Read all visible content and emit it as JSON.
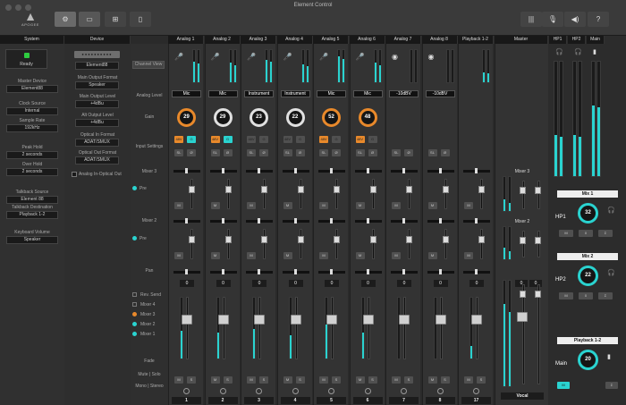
{
  "window": {
    "title": "Element Control"
  },
  "logo": {
    "brand": "APOGEE"
  },
  "toolbar": {
    "left_icons": [
      "settings-icon",
      "device-icon",
      "io-icon",
      "remote-icon"
    ],
    "right_icons": [
      "meter-icon",
      "mic-icon",
      "speaker-icon",
      "help-icon"
    ]
  },
  "system": {
    "header": "System",
    "status": "Ready",
    "fields": [
      {
        "label": "Master Device",
        "value": "Element88"
      },
      {
        "label": "Clock Source",
        "value": "Internal"
      },
      {
        "label": "Sample Rate",
        "value": "192kHz"
      },
      {
        "label": "Peak Hold",
        "value": "2 seconds"
      },
      {
        "label": "Over Hold",
        "value": "2 seconds"
      },
      {
        "label": "Talkback Source",
        "value": "Element 88"
      },
      {
        "label": "Talkback Destination",
        "value": "Playback 1-2"
      },
      {
        "label": "Keyboard Volume",
        "value": "Speaker"
      }
    ]
  },
  "device": {
    "header": "Device",
    "name": "Element88",
    "fields": [
      {
        "label": "Main Output Format",
        "value": "Speaker"
      },
      {
        "label": "Main Output Level",
        "value": "+4dBu"
      },
      {
        "label": "Alt Output Level",
        "value": "+4dBu"
      },
      {
        "label": "Optical In Format",
        "value": "ADAT/SMUX"
      },
      {
        "label": "Optical Out Format",
        "value": "ADAT/SMUX"
      }
    ],
    "checkbox_label": "Analog In-Optical Out"
  },
  "rows": {
    "channel_view": "Channel View",
    "analog_level": "Analog Level",
    "gain": "Gain",
    "input_settings": "Input Settings",
    "mixer3": "Mixer 3",
    "pre": "Pre",
    "mixer2": "Mixer 2",
    "pan": "Pan",
    "rev_send": "Rev. Send",
    "mixer4": "Mixer 4",
    "mixer3b": "Mixer 3",
    "mixer2b": "Mixer 2",
    "mixer1": "Mixer 1",
    "fade": "Fade",
    "mute_solo": "Mute | Solo",
    "mono_stereo": "Mono | Stereo"
  },
  "channels": [
    {
      "name": "Analog 1",
      "level": "Mic",
      "gain": "29",
      "ring": "#e8892b",
      "pan": "0",
      "num": "1",
      "meter": 0.65
    },
    {
      "name": "Analog 2",
      "level": "Mic",
      "gain": "29",
      "ring": "#e0e0e0",
      "pan": "0",
      "num": "2",
      "meter": 0.6
    },
    {
      "name": "Analog 3",
      "level": "Instrument",
      "gain": "23",
      "ring": "#e0e0e0",
      "pan": "0",
      "num": "3",
      "meter": 0.7
    },
    {
      "name": "Analog 4",
      "level": "Instrument",
      "gain": "22",
      "ring": "#e0e0e0",
      "pan": "0",
      "num": "4",
      "meter": 0.55
    },
    {
      "name": "Analog 5",
      "level": "Mic",
      "gain": "52",
      "ring": "#e8892b",
      "pan": "0",
      "num": "5",
      "meter": 0.8
    },
    {
      "name": "Analog 6",
      "level": "Mic",
      "gain": "48",
      "ring": "#e8892b",
      "pan": "0",
      "num": "6",
      "meter": 0.6
    },
    {
      "name": "Analog 7",
      "level": "-10dBV",
      "gain": "",
      "ring": "",
      "pan": "0",
      "num": "7",
      "meter": 0.0
    },
    {
      "name": "Analog 8",
      "level": "-10dBV",
      "gain": "",
      "ring": "",
      "pan": "0",
      "num": "8",
      "meter": 0.0
    },
    {
      "name": "Playback 1-2",
      "level": "",
      "gain": "",
      "ring": "",
      "pan": "0",
      "num": "17",
      "meter": 0.3
    }
  ],
  "master": {
    "header": "Master",
    "mixer3": "Mixer 3",
    "mixer2": "Mixer 2",
    "vocal": "Vocal",
    "pan_l": "0",
    "pan_r": "0"
  },
  "outputs": {
    "headers": [
      "HP1",
      "HP2",
      "Main"
    ],
    "mix1": {
      "title": "Mix 1",
      "label": "HP1",
      "value": "32"
    },
    "mix2": {
      "title": "Mix 2",
      "label": "HP2",
      "value": "22"
    },
    "main": {
      "title": "Playback 1-2",
      "label": "Main",
      "value": "20"
    },
    "btns": [
      "M",
      "0",
      "Σ"
    ]
  },
  "colors": {
    "accent": "#2ad3d0",
    "orange": "#e8892b",
    "bg": "#2a2a2a"
  }
}
